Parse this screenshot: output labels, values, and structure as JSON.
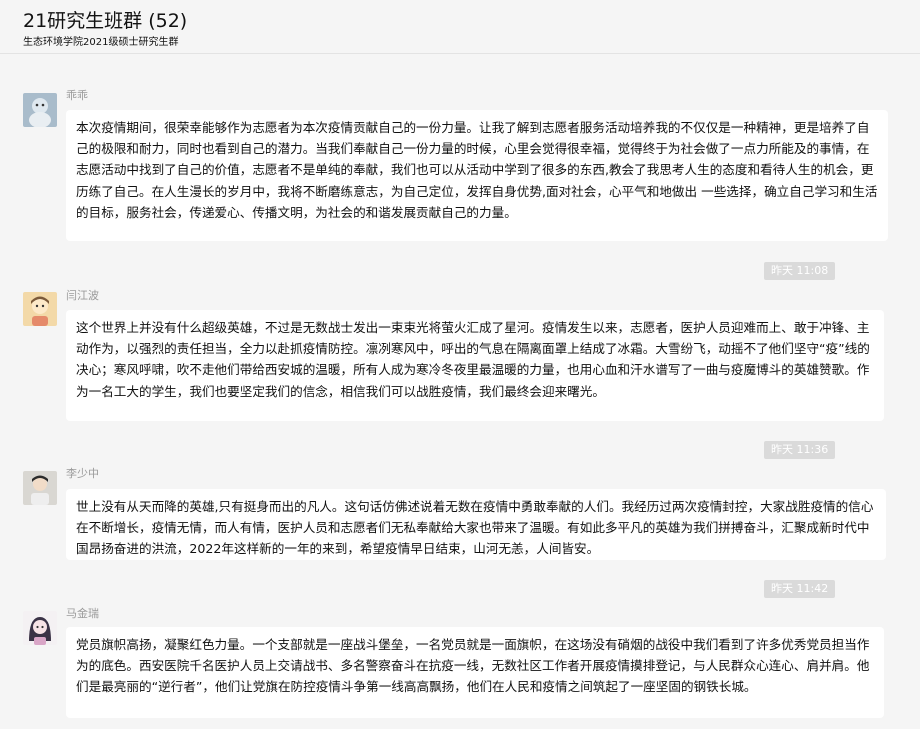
{
  "header": {
    "title": "21研究生班群 (52)",
    "subtitle": "生态环境学院2021级硕士研究生群"
  },
  "messages": [
    {
      "sender": "乖乖",
      "text": "本次疫情期间，很荣幸能够作为志愿者为本次疫情贡献自己的一份力量。让我了解到志愿者服务活动培养我的不仅仅是一种精神，更是培养了自己的极限和耐力，同时也看到自己的潜力。当我们奉献自己一份力量的时候，心里会觉得很幸福，觉得终于为社会做了一点力所能及的事情，在志愿活动中找到了自己的价值，志愿者不是单纯的奉献，我们也可以从活动中学到了很多的东西,教会了我思考人生的态度和看待人生的机会，更历练了自己。在人生漫长的岁月中，我将不断磨练意志，为自己定位，发挥自身优势,面对社会，心平气和地做出 一些选择，确立自己学习和生活的目标，服务社会，传递爱心、传播文明，为社会的和谐发展贡献自己的力量。",
      "time": "昨天 11:08"
    },
    {
      "sender": "闫江波",
      "text": "这个世界上并没有什么超级英雄，不过是无数战士发出一束束光将萤火汇成了星河。疫情发生以来，志愿者，医护人员迎难而上、敢于冲锋、主动作为，以强烈的责任担当，全力以赴抓疫情防控。凛冽寒风中，呼出的气息在隔离面罩上结成了冰霜。大雪纷飞，动摇不了他们坚守“疫”线的决心；寒风呼啸，吹不走他们带给西安城的温暖，所有人成为寒冷冬夜里最温暖的力量，也用心血和汗水谱写了一曲与疫魔博斗的英雄赞歌。作为一名工大的学生，我们也要坚定我们的信念，相信我们可以战胜疫情，我们最终会迎来曙光。",
      "time": "昨天 11:36"
    },
    {
      "sender": "李少中",
      "text": "世上没有从天而降的英雄,只有挺身而出的凡人。这句话仿佛述说着无数在疫情中勇敢奉献的人们。我经历过两次疫情封控，大家战胜疫情的信心在不断增长，疫情无情，而人有情，医护人员和志愿者们无私奉献给大家也带来了温暖。有如此多平凡的英雄为我们拼搏奋斗，汇聚成新时代中国昂扬奋进的洪流，2022年这样新的一年的来到，希望疫情早日结束，山河无恙，人间皆安。",
      "time": "昨天 11:42"
    },
    {
      "sender": "马金瑞",
      "text": "党员旗帜高扬，凝聚红色力量。一个支部就是一座战斗堡垒，一名党员就是一面旗帜，在这场没有硝烟的战役中我们看到了许多优秀党员担当作为的底色。西安医院千名医护人员上交请战书、多名警察奋斗在抗疫一线，无数社区工作者开展疫情摸排登记，与人民群众心连心、肩并肩。他们是最亮丽的“逆行者”，他们让党旗在防控疫情斗争第一线高高飘扬，他们在人民和疫情之间筑起了一座坚固的钢铁长城。",
      "time": ""
    }
  ]
}
